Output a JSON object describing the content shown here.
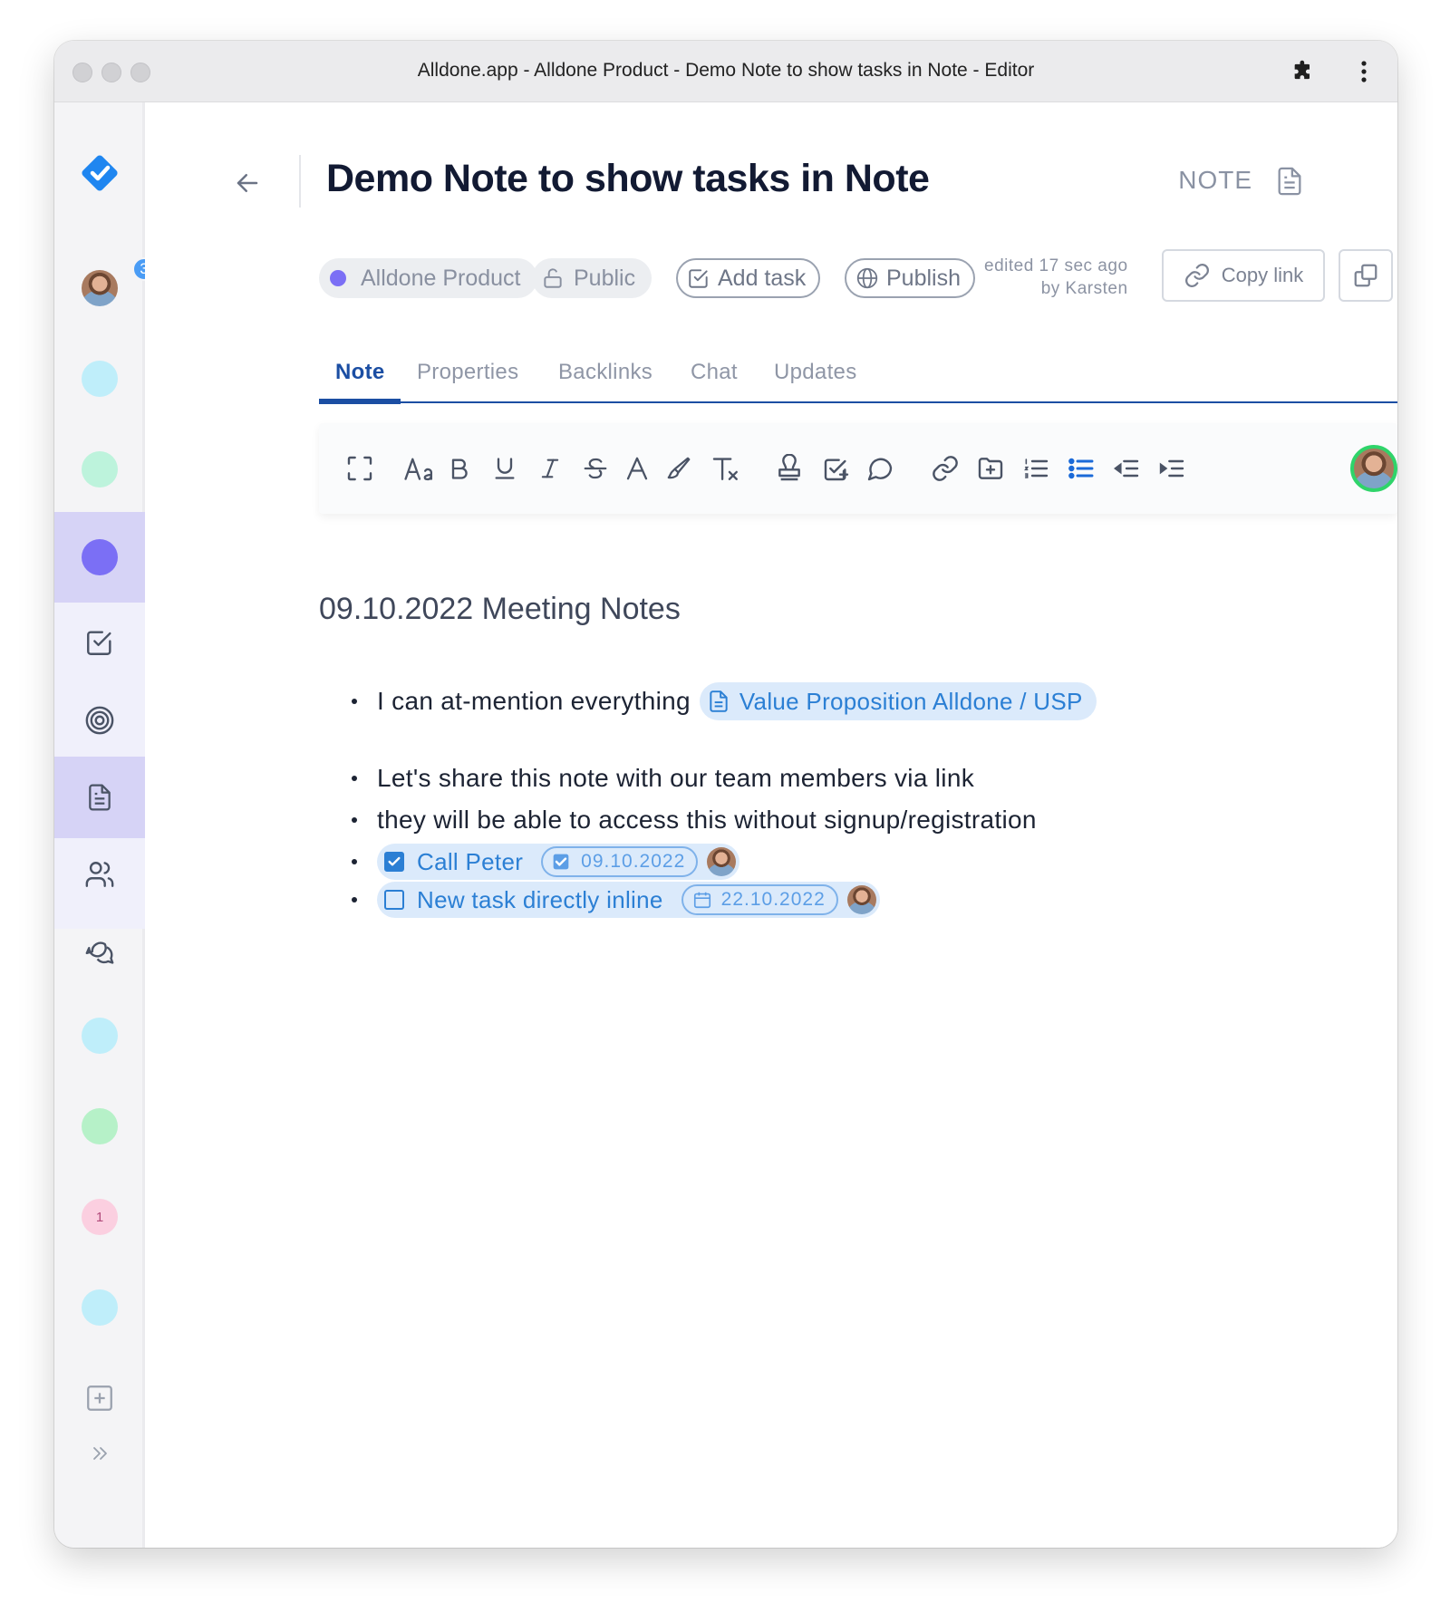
{
  "window": {
    "title": "Alldone.app - Alldone Product - Demo Note to show tasks in Note - Editor"
  },
  "sidebar": {
    "notification_count": "3",
    "pink_badge": "1",
    "colors": {
      "cyan": "#bfeefa",
      "mint": "#bdf3dc",
      "purple": "#7b6ff5",
      "purple_bg": "#d6d3f6",
      "green": "#b6f1c8",
      "pink": "#fbcfe0",
      "icon": "#4a5365"
    }
  },
  "header": {
    "title": "Demo Note to show tasks in Note",
    "type_label": "NOTE"
  },
  "meta": {
    "project_chip": "Alldone Product",
    "project_color": "#7b6ff5",
    "public_chip": "Public",
    "add_task": "Add task",
    "publish": "Publish",
    "edited_line1": "edited 17 sec ago",
    "edited_line2": "by Karsten",
    "copy_link": "Copy link"
  },
  "tabs": [
    "Note",
    "Properties",
    "Backlinks",
    "Chat",
    "Updates"
  ],
  "content": {
    "heading": "09.10.2022 Meeting Notes",
    "bullet1_text": "I can at-mention everything",
    "mention_label": "Value Proposition Alldone / USP",
    "bullet2_text": "Let's share this note with our team members via link",
    "bullet3_text": "they will be able to access this without signup/registration",
    "task1": {
      "label": "Call Peter",
      "date": "09.10.2022",
      "done": true
    },
    "task2": {
      "label": "New task directly inline",
      "date": "22.10.2022",
      "done": false
    }
  },
  "colors": {
    "accent": "#1b4ea3",
    "link_blue": "#2b7fd4",
    "pill_bg": "#dbeafb",
    "online_ring": "#2fd46a"
  }
}
